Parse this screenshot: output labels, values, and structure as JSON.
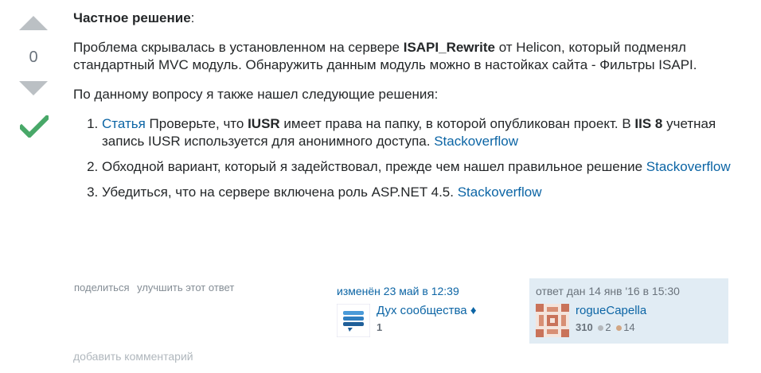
{
  "vote": {
    "count": "0"
  },
  "post": {
    "heading": "Частное решение",
    "heading_suffix": ":",
    "p1": {
      "before": "Проблема скрывалась в установленном на сервере ",
      "bold": "ISAPI_Rewrite",
      "after": " от Helicon, который подменял стандартный MVC модуль. Обнаружить данным модуль можно в настойках сайта - Фильтры ISAPI."
    },
    "p2": "По данному вопросу я также нашел следующие решения:",
    "items": [
      {
        "link": "Статья",
        "t1": " Проверьте, что ",
        "b1": "IUSR",
        "t2": " имеет права на папку, в которой опубликован проект. В ",
        "b2": "IIS 8",
        "t3": " учетная запись IUSR используется для анонимного доступа. ",
        "link2": "Stackoverflow"
      },
      {
        "t1": "Обходной вариант, который я задействовал, прежде чем нашел правильное решение ",
        "link": "Stackoverflow"
      },
      {
        "t1": "Убедиться, что на сервере включена роль ASP.NET 4.5. ",
        "link": "Stackoverflow"
      }
    ]
  },
  "menu": {
    "share": "поделиться",
    "improve": "улучшить этот ответ"
  },
  "edit_sig": {
    "action": "изменён 23 май в 12:39",
    "user_name": "Дух сообщества",
    "diamond": "♦",
    "rep": "1"
  },
  "owner_sig": {
    "action": "ответ дан 14 янв '16 в 15:30",
    "user_name": "rogueCapella",
    "rep": "310",
    "silver": "2",
    "bronze": "14"
  },
  "comments": {
    "add": "добавить комментарий"
  }
}
